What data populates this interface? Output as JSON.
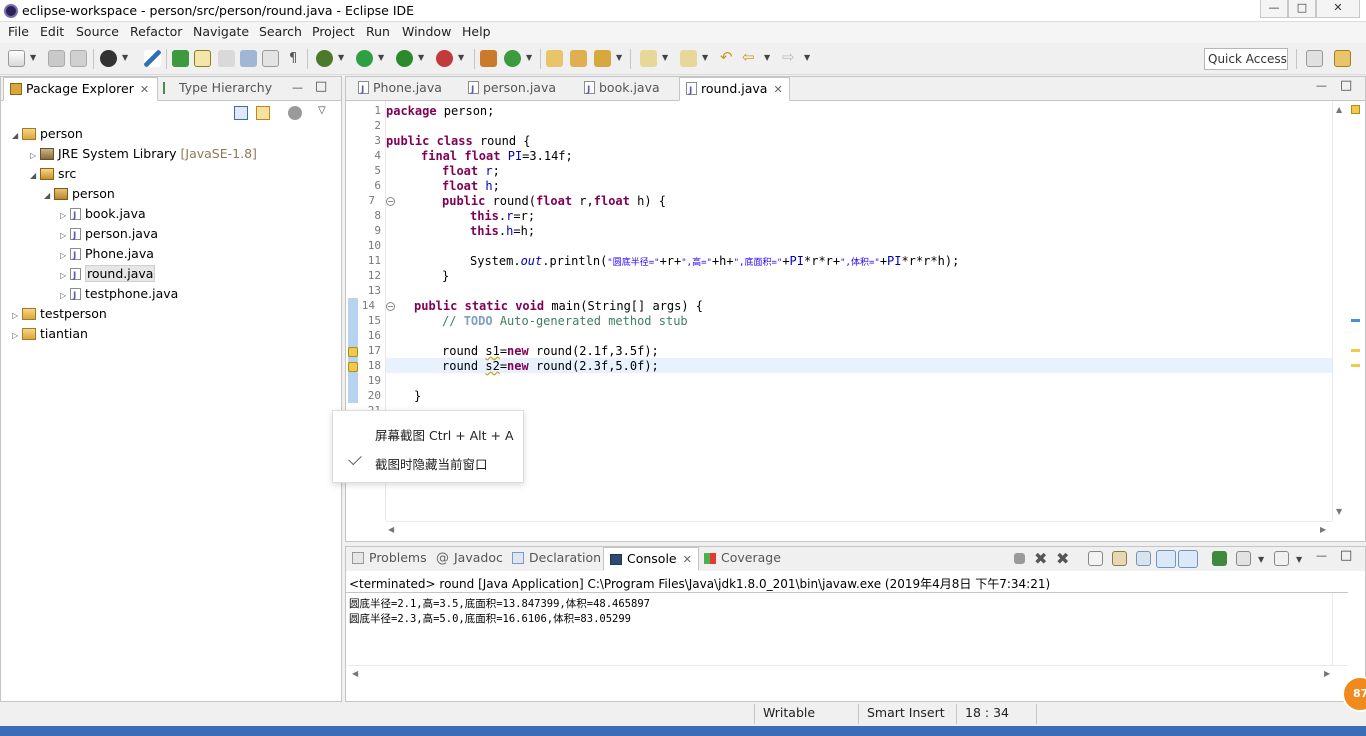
{
  "window": {
    "title": "eclipse-workspace - person/src/person/round.java - Eclipse IDE",
    "minimize_icon": "minimize-icon",
    "maximize_icon": "maximize-icon",
    "close_icon": "close-icon"
  },
  "menu": [
    "File",
    "Edit",
    "Source",
    "Refactor",
    "Navigate",
    "Search",
    "Project",
    "Run",
    "Window",
    "Help"
  ],
  "toolbar": {
    "quick_access": "Quick Access"
  },
  "left_panel": {
    "tabs": [
      {
        "label": "Package Explorer",
        "active": true
      },
      {
        "label": "Type Hierarchy",
        "active": false
      }
    ],
    "tree": [
      {
        "label": "person",
        "icon": "project-icon",
        "expanded": true
      },
      {
        "label": "JRE System Library",
        "suffix": "[JavaSE-1.8]",
        "icon": "library-icon"
      },
      {
        "label": "src",
        "icon": "source-folder-icon",
        "expanded": true
      },
      {
        "label": "person",
        "icon": "package-icon",
        "expanded": true
      },
      {
        "label": "book.java",
        "icon": "java-file-icon"
      },
      {
        "label": "person.java",
        "icon": "java-file-icon"
      },
      {
        "label": "Phone.java",
        "icon": "java-file-icon"
      },
      {
        "label": "round.java",
        "icon": "java-file-icon",
        "selected": true
      },
      {
        "label": "testphone.java",
        "icon": "java-file-icon"
      },
      {
        "label": "testperson",
        "icon": "project-icon"
      },
      {
        "label": "tiantian",
        "icon": "project-icon"
      }
    ]
  },
  "editor": {
    "tabs": [
      {
        "label": "Phone.java"
      },
      {
        "label": "person.java"
      },
      {
        "label": "book.java"
      },
      {
        "label": "round.java",
        "active": true
      }
    ],
    "line_numbers": [
      "1",
      "2",
      "3",
      "4",
      "5",
      "6",
      "7",
      "8",
      "9",
      "10",
      "11",
      "12",
      "13",
      "14",
      "15",
      "16",
      "17",
      "18",
      "19",
      "20",
      "21"
    ],
    "code": {
      "l1_kw": "package",
      "l1_rest": " person;",
      "l3_kw1": "public",
      "l3_kw2": "class",
      "l3_rest": " round {",
      "l4_kw1": "final",
      "l4_kw2": "float",
      "l4_fld": "PI",
      "l4_rest": "=3.14f;",
      "l5_kw": "float",
      "l5_fld": "r",
      "l5_rest": ";",
      "l6_kw": "float",
      "l6_fld": "h",
      "l6_rest": ";",
      "l7_kw": "public",
      "l7_a": " round(",
      "l7_kw2": "float",
      "l7_b": " r,",
      "l7_kw3": "float",
      "l7_c": " h) {",
      "l8_kw": "this",
      "l8_dot": ".",
      "l8_fld": "r",
      "l8_rest": "=r;",
      "l9_kw": "this",
      "l9_dot": ".",
      "l9_fld": "h",
      "l9_rest": "=h;",
      "l11_a": "System.",
      "l11_out": "out",
      "l11_b": ".println(",
      "l11_s1": "\"圆底半径=\"",
      "l11_c": "+r+",
      "l11_s2": "\",高=\"",
      "l11_d": "+h+",
      "l11_s3": "\",底面积=\"",
      "l11_e": "+",
      "l11_pi1": "PI",
      "l11_f": "*r*r+",
      "l11_s4": "\",体积=\"",
      "l11_g": "+",
      "l11_pi2": "PI",
      "l11_h": "*r*r*h);",
      "l12": "}",
      "l14_kw1": "public",
      "l14_kw2": "static",
      "l14_kw3": "void",
      "l14_rest": " main(String[] args) {",
      "l15_cm": "// ",
      "l15_todo": "TODO",
      "l15_rest": " Auto-generated method stub",
      "l17_a": "round ",
      "l17_var": "s1",
      "l17_b": "=",
      "l17_kw": "new",
      "l17_c": " round(2.1f,3.5f);",
      "l18_a": "round ",
      "l18_var": "s2",
      "l18_b": "=",
      "l18_kw": "new",
      "l18_c": " round(2.3f,5.0f);",
      "l20": "}"
    }
  },
  "context_popup": {
    "items": [
      {
        "label": "屏幕截图 Ctrl + Alt + A"
      },
      {
        "label": "截图时隐藏当前窗口",
        "checked": true
      }
    ]
  },
  "bottom_panel": {
    "tabs": [
      {
        "label": "Problems"
      },
      {
        "label": "Javadoc"
      },
      {
        "label": "Declaration"
      },
      {
        "label": "Console",
        "active": true
      },
      {
        "label": "Coverage"
      }
    ],
    "status": "<terminated> round [Java Application] C:\\Program Files\\Java\\jdk1.8.0_201\\bin\\javaw.exe (2019年4月8日 下午7:34:21)",
    "output": [
      "圆底半径=2.1,高=3.5,底面积=13.847399,体积=48.465897",
      "圆底半径=2.3,高=5.0,底面积=16.6106,体积=83.05299"
    ]
  },
  "statusbar": {
    "writable": "Writable",
    "insert_mode": "Smart Insert",
    "position": "18 : 34"
  },
  "badge": "87",
  "colors": {
    "keyword": "#7f0055",
    "field": "#0000c0",
    "string": "#2a00ff",
    "comment": "#3f7f5f",
    "current_line": "#e8f2fe"
  }
}
